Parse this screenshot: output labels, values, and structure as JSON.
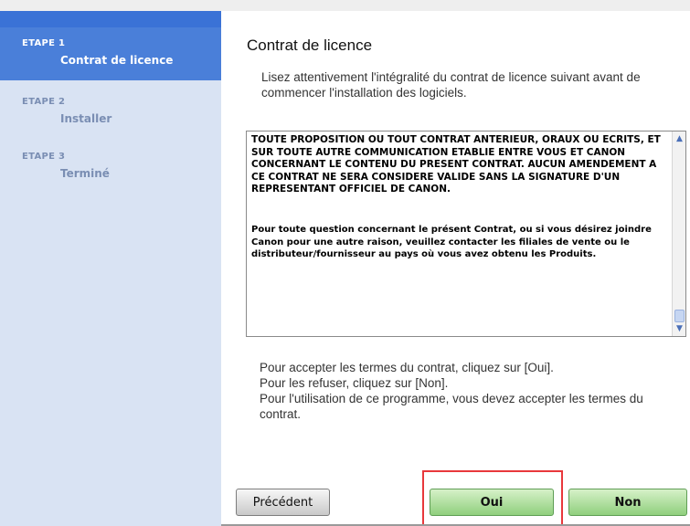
{
  "sidebar": {
    "steps": [
      {
        "label": "ETAPE 1",
        "title": "Contrat de licence"
      },
      {
        "label": "ETAPE 2",
        "title": "Installer"
      },
      {
        "label": "ETAPE 3",
        "title": "Terminé"
      }
    ]
  },
  "main": {
    "title": "Contrat de licence",
    "intro": "Lisez attentivement l'intégralité du contrat de licence suivant avant de commencer l'installation des logiciels.",
    "license_para1": "TOUTE PROPOSITION OU TOUT CONTRAT ANTERIEUR, ORAUX OU ECRITS, ET SUR TOUTE AUTRE COMMUNICATION ETABLIE ENTRE VOUS ET CANON CONCERNANT LE CONTENU DU PRESENT CONTRAT. AUCUN AMENDEMENT A CE CONTRAT NE SERA CONSIDERE VALIDE SANS LA SIGNATURE D'UN REPRESENTANT OFFICIEL DE CANON.",
    "license_para2": "Pour toute question concernant le présent Contrat, ou si vous désirez joindre Canon pour une autre raison, veuillez contacter les filiales de vente ou le distributeur/fournisseur au pays où vous avez obtenu les Produits.",
    "instructions": [
      "Pour accepter les termes du contrat, cliquez sur [Oui].",
      "Pour les refuser, cliquez sur [Non].",
      "Pour l'utilisation de ce programme, vous devez accepter les termes du contrat."
    ]
  },
  "buttons": {
    "previous": "Précédent",
    "yes": "Oui",
    "no": "Non"
  },
  "colors": {
    "sidebar_active": "#4a7fd9",
    "sidebar_bg": "#d9e3f3",
    "accept_green": "#8fcf7d",
    "highlight_red": "#e8383c"
  },
  "icons": {
    "scroll_up": "chevron-up-icon",
    "scroll_down": "chevron-down-icon"
  }
}
